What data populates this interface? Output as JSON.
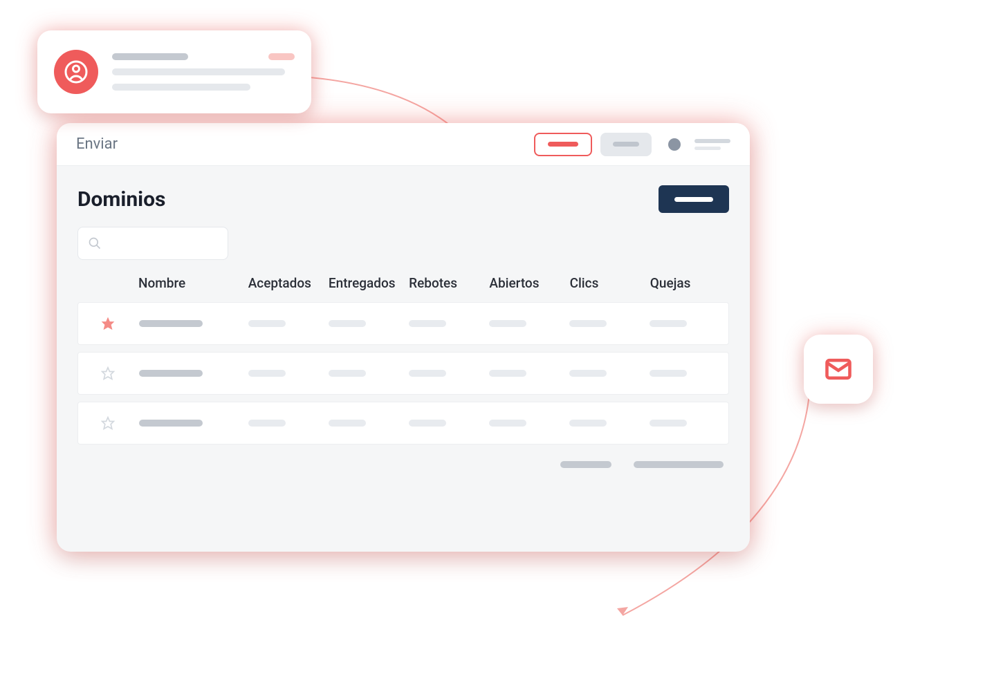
{
  "profile_card": {
    "avatar_icon": "user-circle"
  },
  "window": {
    "title": "Enviar",
    "section_title": "Dominios",
    "search_placeholder": "",
    "columns": {
      "nombre": "Nombre",
      "aceptados": "Aceptados",
      "entregados": "Entregados",
      "rebotes": "Rebotes",
      "abiertos": "Abiertos",
      "clics": "Clics",
      "quejas": "Quejas"
    },
    "rows": [
      {
        "starred": true
      },
      {
        "starred": false
      },
      {
        "starred": false
      }
    ]
  },
  "colors": {
    "accent_red": "#ef5b5b",
    "dark_blue": "#1e3553",
    "gray_text": "#6b7684"
  }
}
